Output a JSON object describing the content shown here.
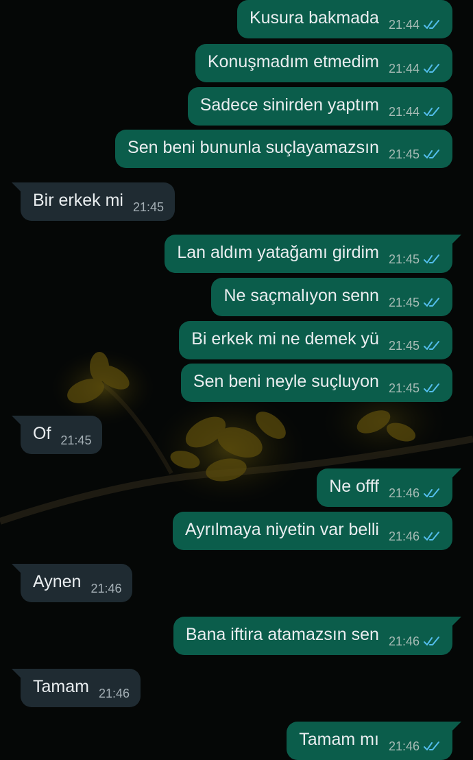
{
  "colors": {
    "background": "#050706",
    "outgoing_bubble": "#0b5d4b",
    "incoming_bubble": "#1f2b32",
    "message_text": "#e9edef",
    "read_ticks": "#53bdeb"
  },
  "read_receipt_icon": "double-check-icon",
  "messages": [
    {
      "direction": "out",
      "text": "Kusura bakmada",
      "time": "21:44"
    },
    {
      "direction": "out",
      "text": "Konuşmadım etmedim",
      "time": "21:44"
    },
    {
      "direction": "out",
      "text": "Sadece sinirden yaptım",
      "time": "21:44"
    },
    {
      "direction": "out",
      "text": "Sen beni bununla suçlayamazsın",
      "time": "21:45"
    },
    {
      "direction": "in",
      "text": "Bir erkek mi",
      "time": "21:45"
    },
    {
      "direction": "out",
      "text": "Lan aldım yatağamı girdim",
      "time": "21:45"
    },
    {
      "direction": "out",
      "text": "Ne saçmalıyon senn",
      "time": "21:45"
    },
    {
      "direction": "out",
      "text": "Bi erkek mi ne demek yü",
      "time": "21:45"
    },
    {
      "direction": "out",
      "text": "Sen beni neyle suçluyon",
      "time": "21:45"
    },
    {
      "direction": "in",
      "text": "Of",
      "time": "21:45"
    },
    {
      "direction": "out",
      "text": "Ne offf",
      "time": "21:46"
    },
    {
      "direction": "out",
      "text": "Ayrılmaya niyetin var belli",
      "time": "21:46"
    },
    {
      "direction": "in",
      "text": "Aynen",
      "time": "21:46"
    },
    {
      "direction": "out",
      "text": "Bana iftira atamazsın sen",
      "time": "21:46"
    },
    {
      "direction": "in",
      "text": "Tamam",
      "time": "21:46"
    },
    {
      "direction": "out",
      "text": "Tamam mı",
      "time": "21:46"
    }
  ]
}
